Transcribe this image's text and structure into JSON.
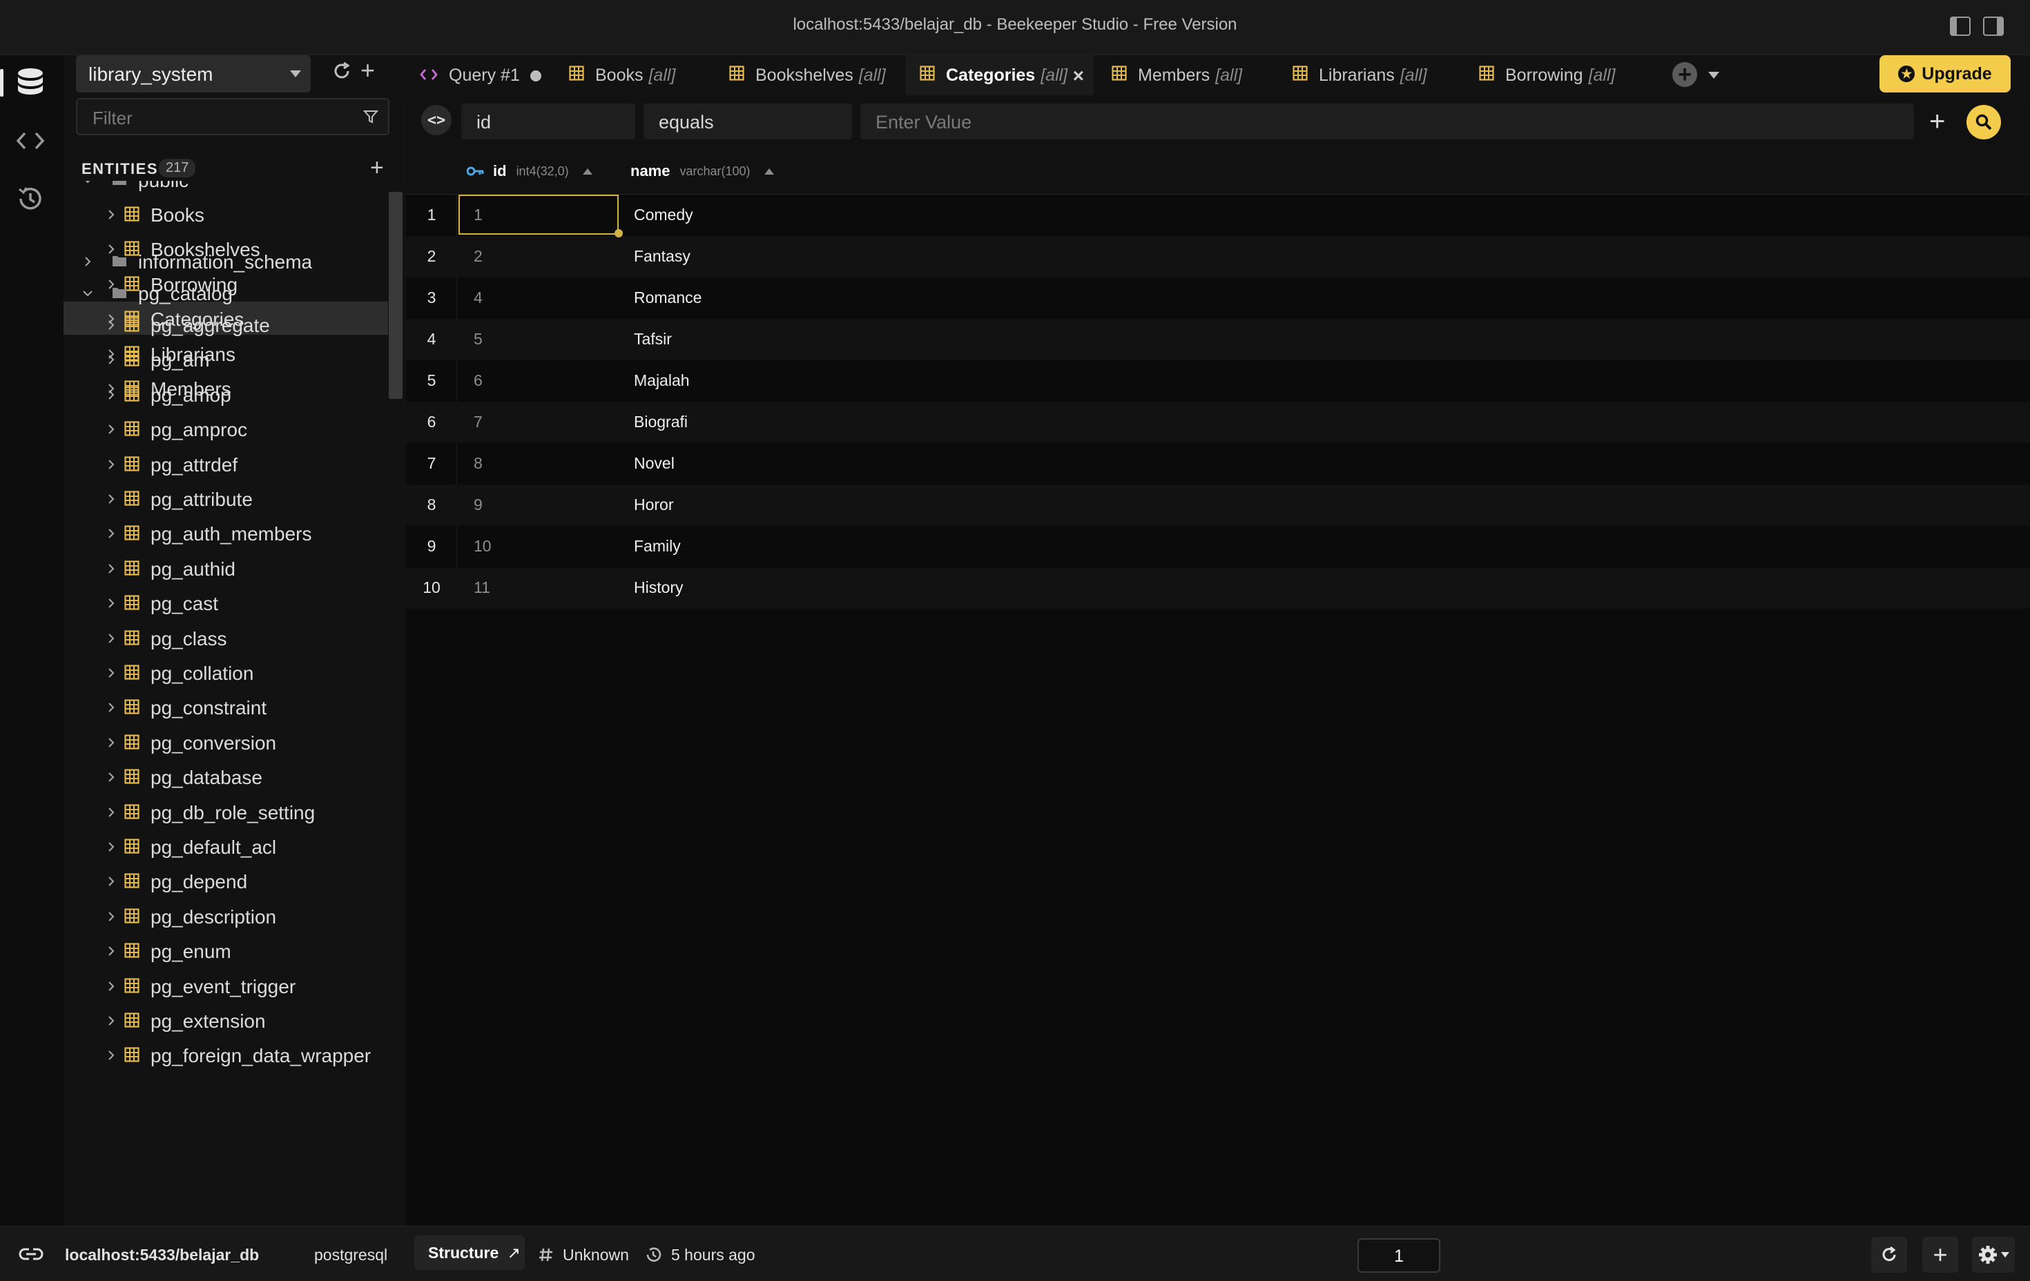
{
  "window": {
    "title": "localhost:5433/belajar_db - Beekeeper Studio - Free Version"
  },
  "sidebar": {
    "connection": "library_system",
    "filter_placeholder": "Filter",
    "entities_label": "ENTITIES",
    "entities_count": "217",
    "public_schema": "public",
    "public_tables": [
      "Books",
      "Bookshelves",
      "Borrowing",
      "Categories",
      "Librarians",
      "Members"
    ],
    "selected_table": "Categories",
    "information_schema": "information_schema",
    "pg_catalog": "pg_catalog",
    "pg_catalog_tables": [
      "pg_aggregate",
      "pg_am",
      "pg_amop",
      "pg_amproc",
      "pg_attrdef",
      "pg_attribute",
      "pg_auth_members",
      "pg_authid",
      "pg_cast",
      "pg_class",
      "pg_collation",
      "pg_constraint",
      "pg_conversion",
      "pg_database",
      "pg_db_role_setting",
      "pg_default_acl",
      "pg_depend",
      "pg_description",
      "pg_enum",
      "pg_event_trigger",
      "pg_extension",
      "pg_foreign_data_wrapper"
    ]
  },
  "tabs": [
    {
      "label": "Query #1",
      "suffix": "",
      "kind": "query",
      "unsaved": true
    },
    {
      "label": "Books",
      "suffix": "[all]",
      "kind": "table"
    },
    {
      "label": "Bookshelves",
      "suffix": "[all]",
      "kind": "table"
    },
    {
      "label": "Categories",
      "suffix": "[all]",
      "kind": "table",
      "active": true
    },
    {
      "label": "Members",
      "suffix": "[all]",
      "kind": "table"
    },
    {
      "label": "Librarians",
      "suffix": "[all]",
      "kind": "table"
    },
    {
      "label": "Borrowing",
      "suffix": "[all]",
      "kind": "table"
    }
  ],
  "upgrade_label": "Upgrade",
  "filter": {
    "field": "id",
    "operator": "equals",
    "value_placeholder": "Enter Value"
  },
  "grid": {
    "columns": [
      {
        "name": "id",
        "type": "int4(32,0)",
        "primary_key": true
      },
      {
        "name": "name",
        "type": "varchar(100)"
      }
    ],
    "rows": [
      {
        "n": "1",
        "id": "1",
        "name": "Comedy"
      },
      {
        "n": "2",
        "id": "2",
        "name": "Fantasy"
      },
      {
        "n": "3",
        "id": "4",
        "name": "Romance"
      },
      {
        "n": "4",
        "id": "5",
        "name": "Tafsir"
      },
      {
        "n": "5",
        "id": "6",
        "name": "Majalah"
      },
      {
        "n": "6",
        "id": "7",
        "name": "Biografi"
      },
      {
        "n": "7",
        "id": "8",
        "name": "Novel"
      },
      {
        "n": "8",
        "id": "9",
        "name": "Horor"
      },
      {
        "n": "9",
        "id": "10",
        "name": "Family"
      },
      {
        "n": "10",
        "id": "11",
        "name": "History"
      }
    ]
  },
  "status": {
    "connection": "localhost:5433/belajar_db",
    "driver": "postgresql",
    "structure_label": "Structure",
    "unknown_label": "Unknown",
    "time_label": "5 hours ago",
    "page": "1"
  },
  "colors": {
    "accent": "#f2cc4a",
    "table_icon": "#e6b94c",
    "key_icon": "#4aa8e8",
    "query_icon": "#c66bd8"
  }
}
